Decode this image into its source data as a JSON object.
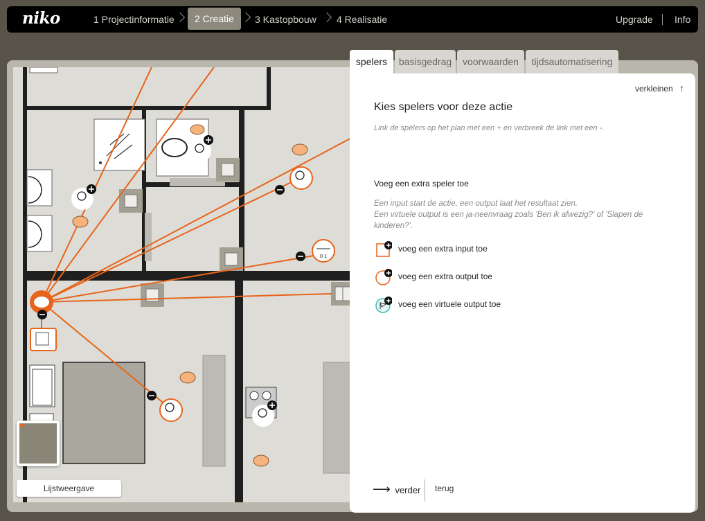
{
  "app": {
    "logo": "niko"
  },
  "nav": {
    "steps": [
      {
        "label": "1 Projectinformatie"
      },
      {
        "label": "2 Creatie"
      },
      {
        "label": "3 Kastopbouw"
      },
      {
        "label": "4 Realisatie"
      }
    ],
    "upgrade": "Upgrade",
    "info": "Info"
  },
  "colors": {
    "accent": "#e7641b",
    "topbar": "#000000",
    "active_step": "#8d8a7d",
    "background": "#58544a"
  },
  "plan": {
    "list_view_label": "Lijstweergave",
    "switch_label": "0-1"
  },
  "panel": {
    "tabs": [
      {
        "label": "spelers"
      },
      {
        "label": "basisgedrag"
      },
      {
        "label": "voorwaarden"
      },
      {
        "label": "tijdsautomatisering"
      }
    ],
    "collapse_label": "verkleinen",
    "title": "Kies spelers voor deze actie",
    "subtitle": "Link de spelers op het plan met een + en verbreek de link met een -.",
    "add_heading": "Voeg een extra speler toe",
    "help_line1": "Een input start de actie, een output laat het resultaat zien.",
    "help_line2": "Een virtuele output is een ja-neenvraag zoals 'Ben ik afwezig?' of 'Slapen de kinderen?'.",
    "add_input": "voeg een extra input toe",
    "add_output": "voeg een extra output toe",
    "add_virtual": "voeg een virtuele output toe",
    "next_label": "verder",
    "back_label": "terug"
  }
}
